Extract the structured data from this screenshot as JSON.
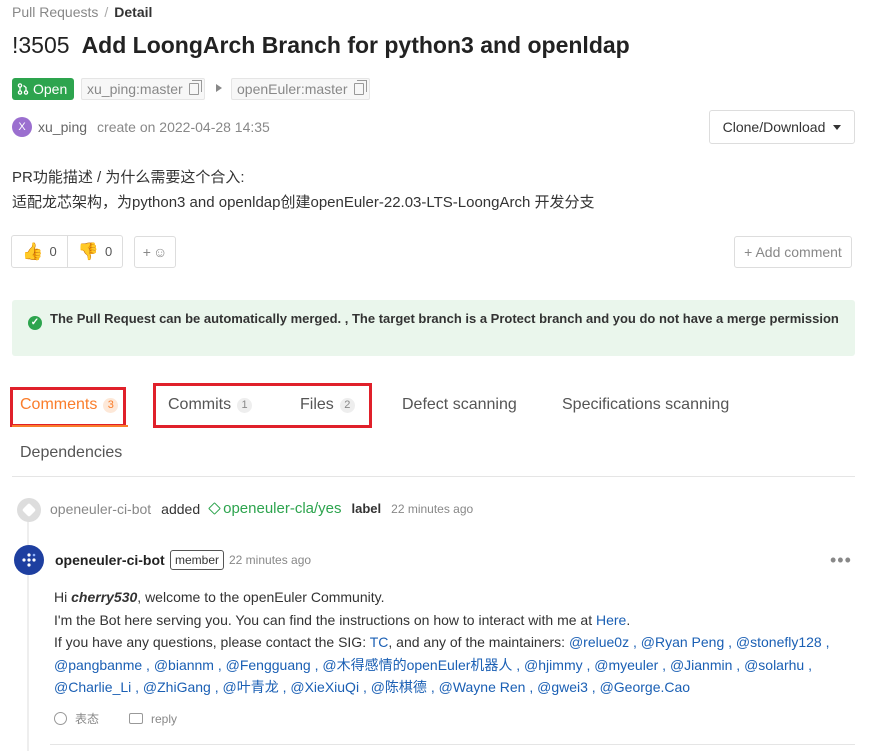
{
  "breadcrumb": {
    "parent": "Pull Requests",
    "separator": "/",
    "current": "Detail"
  },
  "pr": {
    "number": "!3505",
    "title": "Add LoongArch Branch for python3 and openldap",
    "status": "Open",
    "source_branch": "xu_ping:master",
    "target_branch": "openEuler:master",
    "author": "xu_ping",
    "author_initial": "X",
    "created": "create on 2022-04-28 14:35"
  },
  "clone_button": {
    "label": "Clone/Download"
  },
  "description": {
    "line1": "PR功能描述 / 为什么需要这个合入:",
    "line2": "适配龙芯架构，为python3 and openldap创建openEuler-22.03-LTS-LoongArch 开发分支"
  },
  "reactions": {
    "thumbs_up": "0",
    "thumbs_down": "0",
    "add_label": "+",
    "add_comment": "+ Add comment"
  },
  "merge_banner": {
    "text": "The Pull Request can be automatically merged. , The target branch is a Protect branch and you do not have a merge permission"
  },
  "tabs": [
    {
      "label": "Comments",
      "count": "3"
    },
    {
      "label": "Commits",
      "count": "1"
    },
    {
      "label": "Files",
      "count": "2"
    },
    {
      "label": "Defect scanning",
      "count": ""
    },
    {
      "label": "Specifications scanning",
      "count": ""
    },
    {
      "label": "Dependencies",
      "count": ""
    }
  ],
  "label_event": {
    "actor": "openeuler-ci-bot",
    "verb": "added",
    "label": "openeuler-cla/yes",
    "suffix": "label",
    "time": "22 minutes ago"
  },
  "comment": {
    "author": "openeuler-ci-bot",
    "badge": "member",
    "time": "22 minutes ago",
    "more": "•••",
    "line1_prefix": "Hi ",
    "line1_user": "cherry530",
    "line1_suffix": ", welcome to the openEuler Community.",
    "line2_prefix": "I'm the Bot here serving you. You can find the instructions on how to interact with me at ",
    "line2_link": "Here",
    "line2_suffix": ".",
    "line3_prefix": "If you have any questions, please contact the SIG: ",
    "line3_sig": "TC",
    "line3_mid": ", and any of the maintainers: ",
    "line3_mentions": "@relue0z , @Ryan Peng , @stonefly128 ,",
    "line4": "@pangbanme , @biannm , @Fengguang , @木得感情的openEuler机器人 , @hjimmy , @myeuler , @Jianmin , @solarhu ,",
    "line5": "@Charlie_Li , @ZhiGang , @叶青龙 , @XieXiuQi , @陈棋德 , @Wayne Ren , @gwei3 , @George.Cao",
    "action_react": "表态",
    "action_reply": "reply"
  },
  "colors": {
    "open_green": "#2da44e",
    "active_tab": "#fa7d2b",
    "highlight_box": "#e0202a",
    "banner_bg": "#eaf6ec",
    "link_blue": "#1a5fb4"
  }
}
